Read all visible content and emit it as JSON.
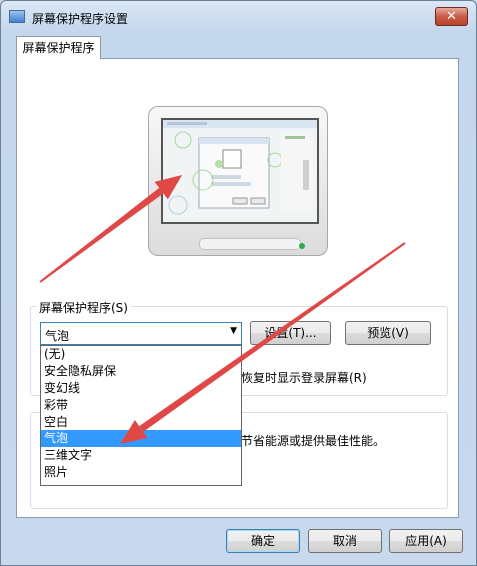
{
  "window": {
    "title": "屏幕保护程序设置",
    "close_label": "✕"
  },
  "tab": {
    "label": "屏幕保护程序"
  },
  "screensaver": {
    "group_label": "屏幕保护程序(S)",
    "selected": "气泡",
    "options": [
      "(无)",
      "安全隐私屏保",
      "变幻线",
      "彩带",
      "空白",
      "气泡",
      "三维文字",
      "照片"
    ],
    "selected_index": 5,
    "settings_button": "设置(T)...",
    "preview_button": "预览(V)",
    "resume_text": "恢复时显示登录屏幕(R)"
  },
  "power": {
    "text_fragment": "节省能源或提供最佳性能。"
  },
  "footer": {
    "ok_button": "确定",
    "cancel_button": "取消",
    "apply_button": "应用(A)"
  },
  "colors": {
    "arrow": "#e04848",
    "selection": "#3399ff"
  }
}
